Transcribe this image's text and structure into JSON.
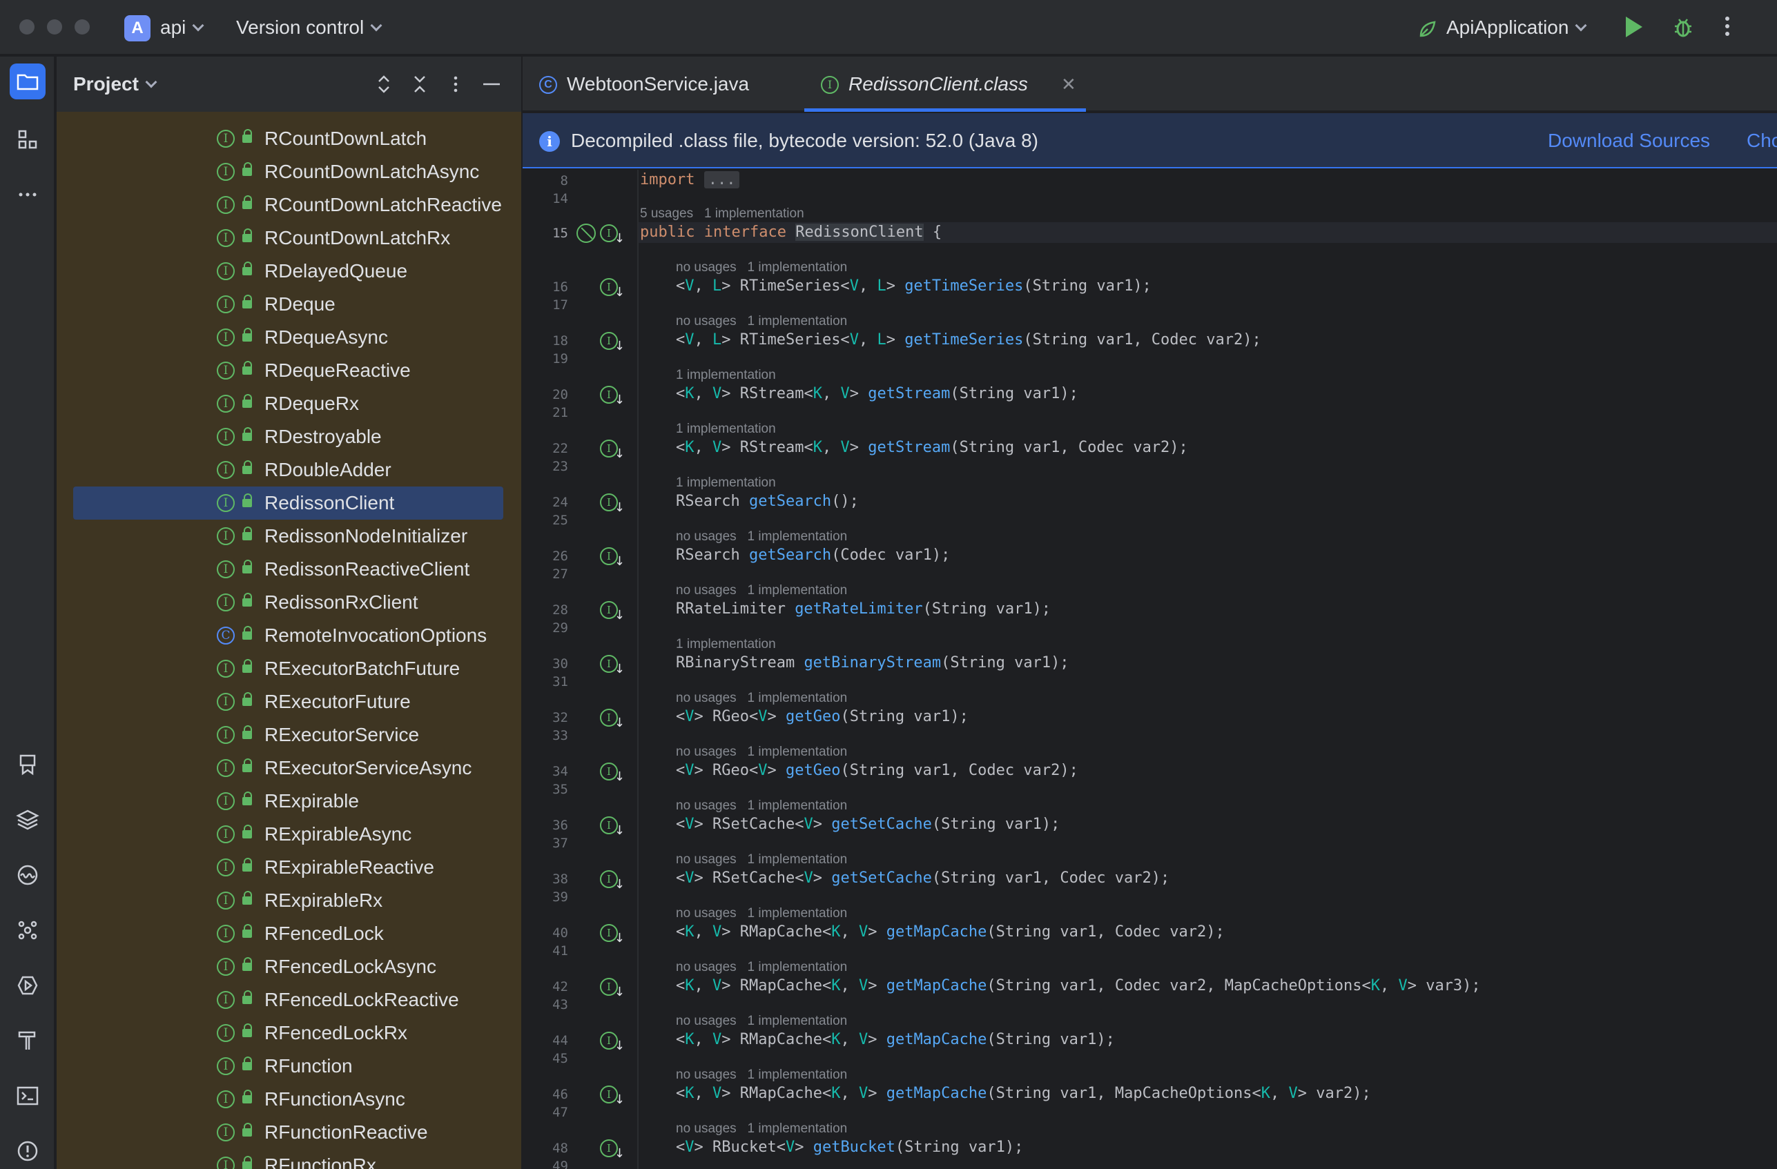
{
  "titlebar": {
    "project_badge": "A",
    "project_name": "api",
    "vcs": "Version control",
    "run_config": "ApiApplication"
  },
  "project_panel": {
    "title": "Project",
    "items": [
      {
        "name": "RCountDownLatch",
        "kind": "interface"
      },
      {
        "name": "RCountDownLatchAsync",
        "kind": "interface"
      },
      {
        "name": "RCountDownLatchReactive",
        "kind": "interface"
      },
      {
        "name": "RCountDownLatchRx",
        "kind": "interface"
      },
      {
        "name": "RDelayedQueue",
        "kind": "interface"
      },
      {
        "name": "RDeque",
        "kind": "interface"
      },
      {
        "name": "RDequeAsync",
        "kind": "interface"
      },
      {
        "name": "RDequeReactive",
        "kind": "interface"
      },
      {
        "name": "RDequeRx",
        "kind": "interface"
      },
      {
        "name": "RDestroyable",
        "kind": "interface"
      },
      {
        "name": "RDoubleAdder",
        "kind": "interface"
      },
      {
        "name": "RedissonClient",
        "kind": "interface",
        "selected": true
      },
      {
        "name": "RedissonNodeInitializer",
        "kind": "interface"
      },
      {
        "name": "RedissonReactiveClient",
        "kind": "interface"
      },
      {
        "name": "RedissonRxClient",
        "kind": "interface"
      },
      {
        "name": "RemoteInvocationOptions",
        "kind": "class"
      },
      {
        "name": "RExecutorBatchFuture",
        "kind": "interface"
      },
      {
        "name": "RExecutorFuture",
        "kind": "interface"
      },
      {
        "name": "RExecutorService",
        "kind": "interface"
      },
      {
        "name": "RExecutorServiceAsync",
        "kind": "interface"
      },
      {
        "name": "RExpirable",
        "kind": "interface"
      },
      {
        "name": "RExpirableAsync",
        "kind": "interface"
      },
      {
        "name": "RExpirableReactive",
        "kind": "interface"
      },
      {
        "name": "RExpirableRx",
        "kind": "interface"
      },
      {
        "name": "RFencedLock",
        "kind": "interface"
      },
      {
        "name": "RFencedLockAsync",
        "kind": "interface"
      },
      {
        "name": "RFencedLockReactive",
        "kind": "interface"
      },
      {
        "name": "RFencedLockRx",
        "kind": "interface"
      },
      {
        "name": "RFunction",
        "kind": "interface"
      },
      {
        "name": "RFunctionAsync",
        "kind": "interface"
      },
      {
        "name": "RFunctionReactive",
        "kind": "interface"
      },
      {
        "name": "RFunctionRx",
        "kind": "interface"
      }
    ]
  },
  "tabs": [
    {
      "label": "WebtoonService.java",
      "icon": "C",
      "active": false
    },
    {
      "label": "RedissonClient.class",
      "icon": "I",
      "active": true
    }
  ],
  "banner": {
    "icon": "i",
    "message": "Decompiled .class file, bytecode version: 52.0 (Java 8)",
    "download": "Download Sources",
    "choose": "Cho"
  },
  "editor": {
    "import_kw": "import",
    "import_fold": "...",
    "class_hint": "5 usages   1 implementation",
    "class_kw1": "public",
    "class_kw2": "interface",
    "class_name": "RedissonClient",
    "class_brace": " {",
    "line_numbers": {
      "l8": "8",
      "l14": "14",
      "l15": "15"
    },
    "methods": [
      {
        "n1": "16",
        "n2": "17",
        "hint": "no usages   1 implementation",
        "code": "<V, L> RTimeSeries<V, L> getTimeSeries(String var1);"
      },
      {
        "n1": "18",
        "n2": "19",
        "hint": "no usages   1 implementation",
        "code": "<V, L> RTimeSeries<V, L> getTimeSeries(String var1, Codec var2);"
      },
      {
        "n1": "20",
        "n2": "21",
        "hint": "1 implementation",
        "code": "<K, V> RStream<K, V> getStream(String var1);"
      },
      {
        "n1": "22",
        "n2": "23",
        "hint": "1 implementation",
        "code": "<K, V> RStream<K, V> getStream(String var1, Codec var2);"
      },
      {
        "n1": "24",
        "n2": "25",
        "hint": "1 implementation",
        "code": "RSearch getSearch();"
      },
      {
        "n1": "26",
        "n2": "27",
        "hint": "no usages   1 implementation",
        "code": "RSearch getSearch(Codec var1);"
      },
      {
        "n1": "28",
        "n2": "29",
        "hint": "no usages   1 implementation",
        "code": "RRateLimiter getRateLimiter(String var1);"
      },
      {
        "n1": "30",
        "n2": "31",
        "hint": "1 implementation",
        "code": "RBinaryStream getBinaryStream(String var1);"
      },
      {
        "n1": "32",
        "n2": "33",
        "hint": "no usages   1 implementation",
        "code": "<V> RGeo<V> getGeo(String var1);"
      },
      {
        "n1": "34",
        "n2": "35",
        "hint": "no usages   1 implementation",
        "code": "<V> RGeo<V> getGeo(String var1, Codec var2);"
      },
      {
        "n1": "36",
        "n2": "37",
        "hint": "no usages   1 implementation",
        "code": "<V> RSetCache<V> getSetCache(String var1);"
      },
      {
        "n1": "38",
        "n2": "39",
        "hint": "no usages   1 implementation",
        "code": "<V> RSetCache<V> getSetCache(String var1, Codec var2);"
      },
      {
        "n1": "40",
        "n2": "41",
        "hint": "no usages   1 implementation",
        "code": "<K, V> RMapCache<K, V> getMapCache(String var1, Codec var2);"
      },
      {
        "n1": "42",
        "n2": "43",
        "hint": "no usages   1 implementation",
        "code": "<K, V> RMapCache<K, V> getMapCache(String var1, Codec var2, MapCacheOptions<K, V> var3);"
      },
      {
        "n1": "44",
        "n2": "45",
        "hint": "no usages   1 implementation",
        "code": "<K, V> RMapCache<K, V> getMapCache(String var1);"
      },
      {
        "n1": "46",
        "n2": "47",
        "hint": "no usages   1 implementation",
        "code": "<K, V> RMapCache<K, V> getMapCache(String var1, MapCacheOptions<K, V> var2);"
      },
      {
        "n1": "48",
        "n2": "49",
        "hint": "no usages   1 implementation",
        "code": "<V> RBucket<V> getBucket(String var1);"
      }
    ],
    "trailing_hint": "no usages   1 implementation",
    "gutter_icon": "I"
  }
}
